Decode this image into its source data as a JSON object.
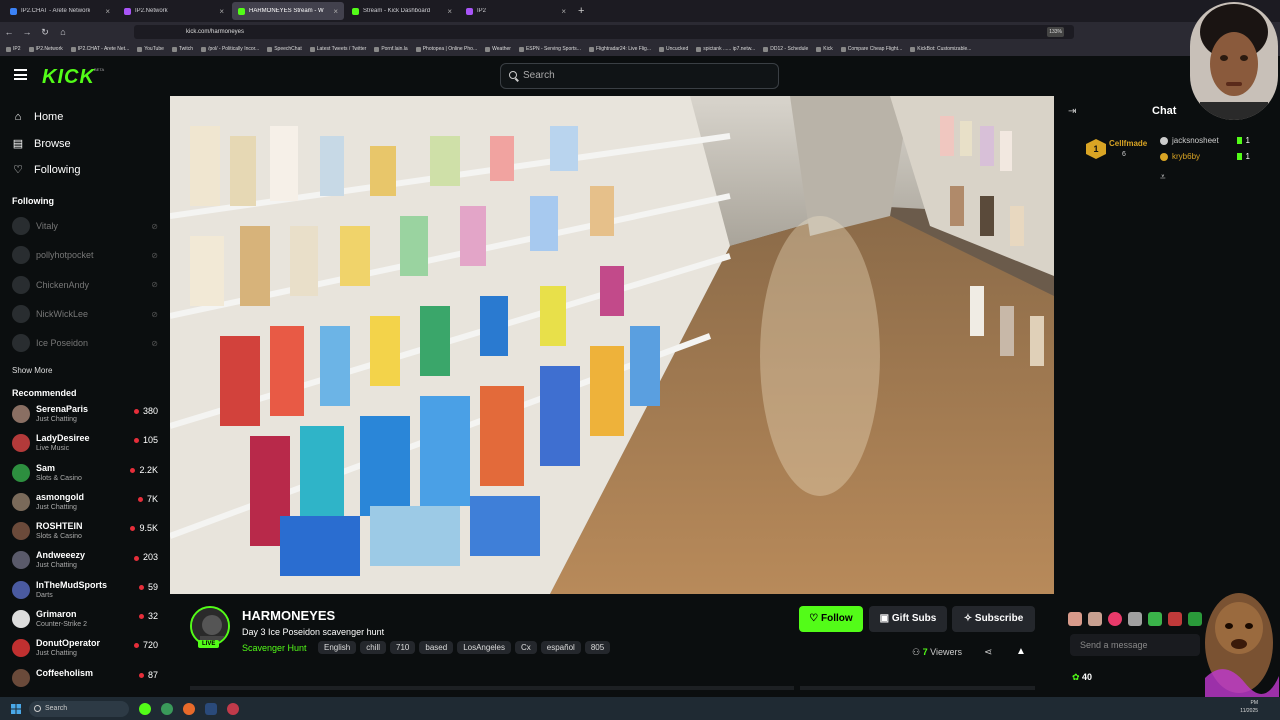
{
  "browser": {
    "tabs": [
      {
        "label": "IP2.CHAT - Arete Network",
        "active": false,
        "color": "#3b82f6"
      },
      {
        "label": "IP2.Network",
        "active": false,
        "color": "#a855f7"
      },
      {
        "label": "HARMONEYES Stream - W",
        "active": true,
        "color": "#53fc18"
      },
      {
        "label": "Stream - Kick Dashboard",
        "active": false,
        "color": "#53fc18"
      },
      {
        "label": "IP2",
        "active": false,
        "color": "#a855f7"
      }
    ],
    "url": "kick.com/harmoneyes",
    "zoom": "133%",
    "bookmarks": [
      "IP2",
      "IP2.Network",
      "IP2.CHAT - Arete Net...",
      "YouTube",
      "Twitch",
      "/pol/ - Politically Incor...",
      "SpeechChat",
      "Latest Tweets / Twitter",
      "Pornf.lain.la",
      "Photopea | Online Pho...",
      "Weather",
      "ESPN - Serving Sports...",
      "Flightradar24: Live Flig...",
      "Uncucked",
      "spictank ...... ip7.netw...",
      "DD12 - Schedule",
      "Kick",
      "Compare Cheap Flight...",
      "KickBot: Customizable..."
    ]
  },
  "kick": {
    "logo": "KICK",
    "beta": "BETA",
    "search_placeholder": "Search"
  },
  "sidebar": {
    "nav": [
      {
        "label": "Home",
        "icon": "home-icon",
        "glyph": "⌂"
      },
      {
        "label": "Browse",
        "icon": "browse-icon",
        "glyph": "▤"
      },
      {
        "label": "Following",
        "icon": "heart-icon",
        "glyph": "♡"
      }
    ],
    "following_title": "Following",
    "following": [
      "Vitaly",
      "pollyhotpocket",
      "ChickenAndy",
      "NickWickLee",
      "Ice Poseidon"
    ],
    "show_more": "Show More",
    "recommended_title": "Recommended",
    "recommended": [
      {
        "name": "SerenaParis",
        "category": "Just Chatting",
        "viewers": "380",
        "color": "#8a6f63"
      },
      {
        "name": "LadyDesiree",
        "category": "Live Music",
        "viewers": "105",
        "color": "#b33a3a"
      },
      {
        "name": "Sam",
        "category": "Slots & Casino",
        "viewers": "2.2K",
        "color": "#2d8f3f"
      },
      {
        "name": "asmongold",
        "category": "Just Chatting",
        "viewers": "7K",
        "color": "#7a6a5a"
      },
      {
        "name": "ROSHTEIN",
        "category": "Slots & Casino",
        "viewers": "9.5K",
        "color": "#6b4a3a"
      },
      {
        "name": "Andweeezy",
        "category": "Just Chatting",
        "viewers": "203",
        "color": "#5a5a6a"
      },
      {
        "name": "InTheMudSports",
        "category": "Darts",
        "viewers": "59",
        "color": "#4a5aa0"
      },
      {
        "name": "Grimaron",
        "category": "Counter-Strike 2",
        "viewers": "32",
        "color": "#ddd"
      },
      {
        "name": "DonutOperator",
        "category": "Just Chatting",
        "viewers": "720",
        "color": "#c03030"
      },
      {
        "name": "Coffeeholism",
        "category": "",
        "viewers": "87",
        "color": "#6a4a3a"
      }
    ]
  },
  "stream": {
    "channel": "HARMONEYES",
    "live": "LIVE",
    "title": "Day 3 Ice Poseidon scavenger hunt",
    "category": "Scavenger Hunt",
    "tags": [
      "English",
      "chill",
      "710",
      "based",
      "LosAngeles",
      "Cx",
      "español",
      "805"
    ],
    "follow_label": "Follow",
    "gift_label": "Gift Subs",
    "subscribe_label": "Subscribe",
    "viewers": "7",
    "viewers_label": "Viewers"
  },
  "chat": {
    "title": "Chat",
    "leader_rank": "1",
    "leader_name": "Cellfmade",
    "leader_count": "6",
    "gifters": [
      {
        "name": "jacksnosheet",
        "count": "1",
        "color": "#cccccc"
      },
      {
        "name": "kryb6by",
        "count": "1",
        "color": "#d9a424"
      }
    ],
    "message_placeholder": "Send a message",
    "points": "40"
  },
  "taskbar": {
    "search": "Search",
    "time": "PM",
    "date": "11/2025"
  }
}
